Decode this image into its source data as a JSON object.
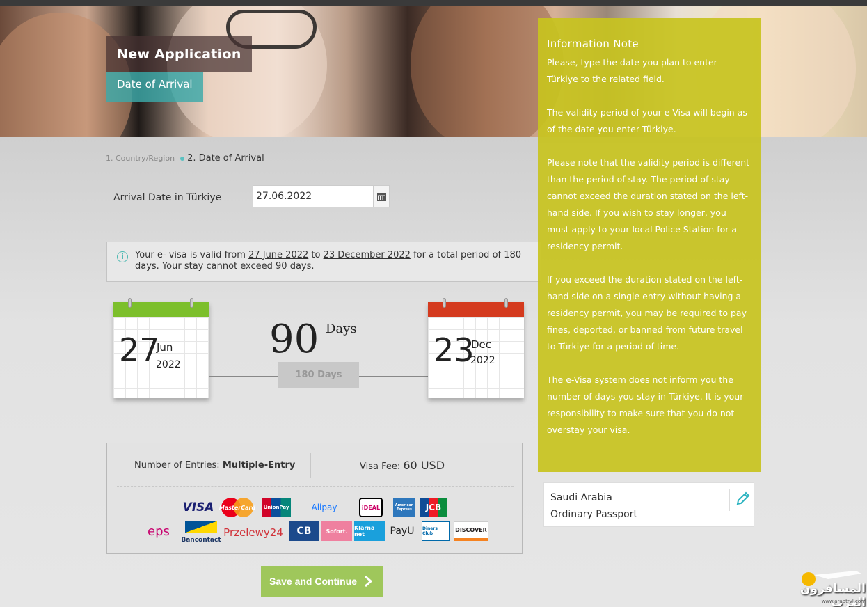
{
  "header": {
    "title": "New Application",
    "subtitle": "Date of Arrival"
  },
  "steps": {
    "step1": "1. Country/Region",
    "step2": "2. Date of Arrival"
  },
  "arrival": {
    "label": "Arrival Date in Türkiye",
    "value": "27.06.2022",
    "calendar_icon": "calendar-icon"
  },
  "validity": {
    "prefix": "Your e- visa is valid from",
    "from": "27 June 2022",
    "to_word": "to",
    "to": "23 December 2022",
    "middle": "for a total period of 180 days. Your stay cannot exceed 90 days."
  },
  "calendar_start": {
    "day": "27",
    "month": "Jun",
    "year": "2022",
    "color": "#7cbf2b"
  },
  "calendar_end": {
    "day": "23",
    "month": "Dec",
    "year": "2022",
    "color": "#d43a1e"
  },
  "stay": {
    "number": "90",
    "unit": "Days",
    "validity_label": "180 Days"
  },
  "fee": {
    "entries_label": "Number of Entries:",
    "entries_value": "Multiple-Entry",
    "fee_label": "Visa Fee:",
    "fee_value": "60 USD"
  },
  "payment_logos": {
    "row1": [
      "VISA",
      "MasterCard",
      "UnionPay",
      "Alipay",
      "iDEAL",
      "American Express",
      "JCB"
    ],
    "row2": [
      "eps",
      "Bancontact",
      "Przelewy24",
      "CB",
      "Sofort.",
      "Klarna net",
      "PayU",
      "Diners Club",
      "DISCOVER"
    ]
  },
  "save_button": "Save and Continue",
  "note": {
    "title": "Information Note",
    "paragraphs": [
      "Please, type the date you plan to enter Türkiye to the related field.",
      "The validity period of your e-Visa will begin as of the date you enter Türkiye.",
      "Please note that the validity period is different than the period of stay. The period of stay cannot exceed the duration stated on the left-hand side. If you wish to stay longer, you must apply to your local Police Station for a residency permit.",
      "If you exceed the duration stated on the left-hand side on a single entry without having a residency permit, you may be required to pay fines, deported, or banned from future travel to Türkiye for a period of time.",
      "The e-Visa system does not inform you the number of days you stay in Türkiye. It is your responsibility to make sure that you do not overstay your visa."
    ]
  },
  "passport": {
    "country": "Saudi Arabia",
    "type": "Ordinary Passport"
  },
  "watermark": {
    "brand": "المسافرون العرب",
    "url": "www.arabtrvl.com"
  }
}
